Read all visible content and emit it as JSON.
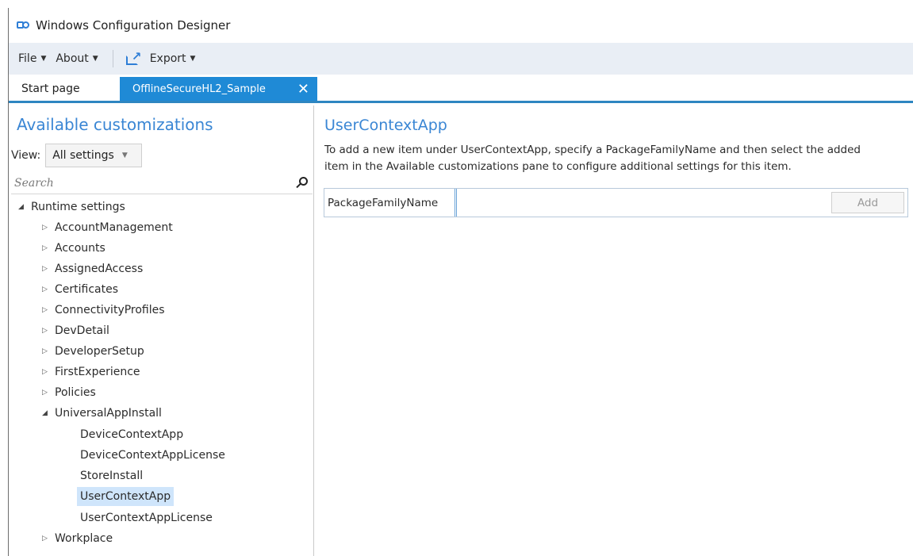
{
  "app": {
    "title": "Windows Configuration Designer"
  },
  "menu": {
    "file": "File",
    "about": "About",
    "export": "Export"
  },
  "tabs": [
    {
      "label": "Start page"
    },
    {
      "label": "OfflineSecureHL2_Sample",
      "close": "✕"
    }
  ],
  "left": {
    "title": "Available customizations",
    "view_label": "View:",
    "view_value": "All settings",
    "search_placeholder": "Search",
    "tree": [
      "Runtime settings",
      "AccountManagement",
      "Accounts",
      "AssignedAccess",
      "Certificates",
      "ConnectivityProfiles",
      "DevDetail",
      "DeveloperSetup",
      "FirstExperience",
      "Policies",
      "UniversalAppInstall",
      "DeviceContextApp",
      "DeviceContextAppLicense",
      "StoreInstall",
      "UserContextApp",
      "UserContextAppLicense",
      "Workplace"
    ]
  },
  "main": {
    "title": "UserContextApp",
    "desc_line1": "To add a new item under UserContextApp, specify a PackageFamilyName and then select the added",
    "desc_line2": "item in the Available customizations pane to configure additional settings for this item.",
    "field_label": "PackageFamilyName",
    "field_value": "",
    "add_label": "Add"
  }
}
